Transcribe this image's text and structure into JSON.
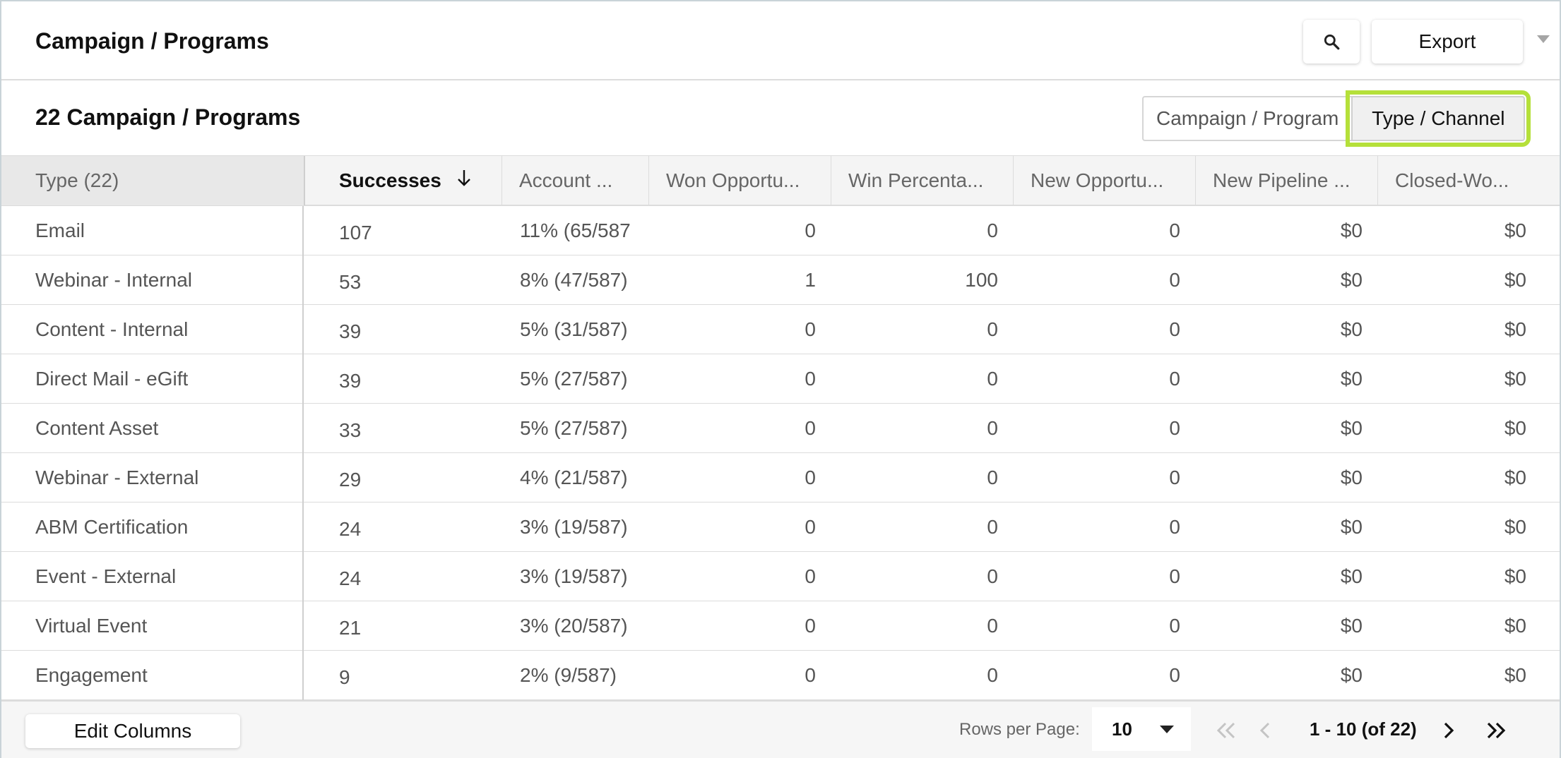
{
  "header": {
    "title": "Campaign / Programs",
    "search_icon": "search-icon",
    "export_label": "Export"
  },
  "subheader": {
    "count_title": "22 Campaign / Programs",
    "toggle_left": "Campaign / Program",
    "toggle_right": "Type / Channel",
    "highlight_color": "#b5e03a"
  },
  "table": {
    "columns": [
      "Type (22)",
      "Successes",
      "Account ...",
      "Won Opportu...",
      "Win Percenta...",
      "New Opportu...",
      "New Pipeline ...",
      "Closed-Wo..."
    ],
    "sort_icon": "arrow-down-icon",
    "rows": [
      [
        "Email",
        "107",
        "11% (65/587",
        "0",
        "0",
        "0",
        "$0",
        "$0"
      ],
      [
        "Webinar - Internal",
        "53",
        "8% (47/587)",
        "1",
        "100",
        "0",
        "$0",
        "$0"
      ],
      [
        "Content - Internal",
        "39",
        "5% (31/587)",
        "0",
        "0",
        "0",
        "$0",
        "$0"
      ],
      [
        "Direct Mail - eGift",
        "39",
        "5% (27/587)",
        "0",
        "0",
        "0",
        "$0",
        "$0"
      ],
      [
        "Content Asset",
        "33",
        "5% (27/587)",
        "0",
        "0",
        "0",
        "$0",
        "$0"
      ],
      [
        "Webinar - External",
        "29",
        "4% (21/587)",
        "0",
        "0",
        "0",
        "$0",
        "$0"
      ],
      [
        "ABM Certification",
        "24",
        "3% (19/587)",
        "0",
        "0",
        "0",
        "$0",
        "$0"
      ],
      [
        "Event - External",
        "24",
        "3% (19/587)",
        "0",
        "0",
        "0",
        "$0",
        "$0"
      ],
      [
        "Virtual Event",
        "21",
        "3% (20/587)",
        "0",
        "0",
        "0",
        "$0",
        "$0"
      ],
      [
        "Engagement",
        "9",
        "2% (9/587)",
        "0",
        "0",
        "0",
        "$0",
        "$0"
      ]
    ]
  },
  "footer": {
    "edit_columns": "Edit Columns",
    "rows_per_page_label": "Rows per Page:",
    "rows_per_page_value": "10",
    "range": "1 - 10 (of 22)",
    "first_icon": "first-page-icon",
    "prev_icon": "prev-page-icon",
    "next_icon": "next-page-icon",
    "last_icon": "last-page-icon"
  }
}
